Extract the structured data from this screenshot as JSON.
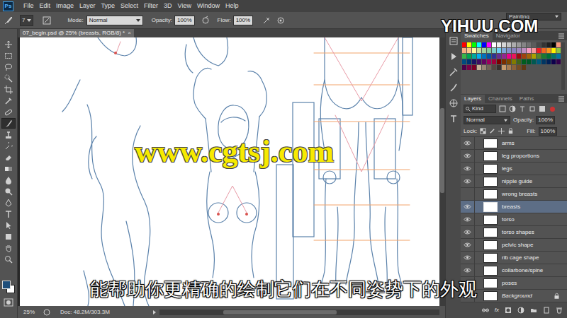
{
  "app": {
    "logo": "Ps",
    "workspace": "Painting"
  },
  "menu": [
    "File",
    "Edit",
    "Image",
    "Layer",
    "Type",
    "Select",
    "Filter",
    "3D",
    "View",
    "Window",
    "Help"
  ],
  "options": {
    "brush_size": "7",
    "mode_label": "Mode:",
    "mode": "Normal",
    "opacity_label": "Opacity:",
    "opacity": "100%",
    "flow_label": "Flow:",
    "flow": "100%"
  },
  "document": {
    "tab_title": "07_begin.psd @ 25% (breasts, RGB/8) *",
    "close": "×"
  },
  "toolbar": {
    "tools": [
      {
        "selected": false
      },
      {
        "selected": false
      },
      {
        "selected": false
      },
      {
        "selected": false
      },
      {
        "selected": false
      },
      {
        "selected": false
      },
      {
        "selected": false
      },
      {
        "selected": true
      },
      {
        "selected": false
      },
      {
        "selected": false
      },
      {
        "selected": false
      },
      {
        "selected": false
      },
      {
        "selected": false
      },
      {
        "selected": false
      },
      {
        "selected": false
      },
      {
        "selected": false
      },
      {
        "selected": false
      },
      {
        "selected": false
      },
      {
        "selected": false
      },
      {
        "selected": false
      }
    ],
    "foreground_color": "#1f4e7a",
    "background_color": "#ffffff"
  },
  "swatches_panel": {
    "tabs": [
      {
        "label": "Swatches",
        "selected": true
      },
      {
        "label": "Navigator",
        "selected": false
      }
    ],
    "swatches": [
      {
        "color": "#ff0000"
      },
      {
        "color": "#ffff00"
      },
      {
        "color": "#00ff00"
      },
      {
        "color": "#00ffff"
      },
      {
        "color": "#0000ff"
      },
      {
        "color": "#ff00ff"
      },
      {
        "color": "#ffffff"
      },
      {
        "color": "#ebebeb"
      },
      {
        "color": "#d6d6d6"
      },
      {
        "color": "#c2c2c2"
      },
      {
        "color": "#adadad"
      },
      {
        "color": "#999999"
      },
      {
        "color": "#858585"
      },
      {
        "color": "#707070"
      },
      {
        "color": "#5c5c5c"
      },
      {
        "color": "#474747"
      },
      {
        "color": "#333333"
      },
      {
        "color": "#1f1f1f"
      },
      {
        "color": "#000000"
      },
      {
        "color": "#f7977a"
      },
      {
        "color": "#f9ad81"
      },
      {
        "color": "#fdc68a"
      },
      {
        "color": "#fff79a"
      },
      {
        "color": "#c4df9b"
      },
      {
        "color": "#a2d39c"
      },
      {
        "color": "#82ca9d"
      },
      {
        "color": "#7bcdc8"
      },
      {
        "color": "#6ecff6"
      },
      {
        "color": "#7ea7d8"
      },
      {
        "color": "#8493ca"
      },
      {
        "color": "#8882be"
      },
      {
        "color": "#a187be"
      },
      {
        "color": "#bc8dbf"
      },
      {
        "color": "#f49ac2"
      },
      {
        "color": "#f6989d"
      },
      {
        "color": "#ed1c24"
      },
      {
        "color": "#f26522"
      },
      {
        "color": "#f7941d"
      },
      {
        "color": "#fff200"
      },
      {
        "color": "#8dc73f"
      },
      {
        "color": "#39b54a"
      },
      {
        "color": "#00a651"
      },
      {
        "color": "#00a99d"
      },
      {
        "color": "#00aeef"
      },
      {
        "color": "#0072bc"
      },
      {
        "color": "#0054a6"
      },
      {
        "color": "#2e3192"
      },
      {
        "color": "#662d91"
      },
      {
        "color": "#92278f"
      },
      {
        "color": "#ec008c"
      },
      {
        "color": "#ed145b"
      },
      {
        "color": "#9e0b0f"
      },
      {
        "color": "#a0410d"
      },
      {
        "color": "#a3620a"
      },
      {
        "color": "#aba000"
      },
      {
        "color": "#598527"
      },
      {
        "color": "#1a7b30"
      },
      {
        "color": "#007236"
      },
      {
        "color": "#00746b"
      },
      {
        "color": "#0076a3"
      },
      {
        "color": "#004b80"
      },
      {
        "color": "#003471"
      },
      {
        "color": "#1b1464"
      },
      {
        "color": "#440e62"
      },
      {
        "color": "#630460"
      },
      {
        "color": "#9e005d"
      },
      {
        "color": "#9e0039"
      },
      {
        "color": "#790000"
      },
      {
        "color": "#7b2e00"
      },
      {
        "color": "#7d4900"
      },
      {
        "color": "#827b00"
      },
      {
        "color": "#406618"
      },
      {
        "color": "#005e20"
      },
      {
        "color": "#005826"
      },
      {
        "color": "#005952"
      },
      {
        "color": "#005b7f"
      },
      {
        "color": "#003663"
      },
      {
        "color": "#002157"
      },
      {
        "color": "#0d004c"
      },
      {
        "color": "#32004b"
      },
      {
        "color": "#4b0049"
      },
      {
        "color": "#7b0046"
      },
      {
        "color": "#7a0026"
      },
      {
        "color": "#c7b299"
      },
      {
        "color": "#998675"
      },
      {
        "color": "#736357"
      },
      {
        "color": "#534741"
      },
      {
        "color": "#37302d"
      },
      {
        "color": "#c69c6d"
      },
      {
        "color": "#a67c52"
      },
      {
        "color": "#8c6239"
      },
      {
        "color": "#754c24"
      },
      {
        "color": "#603913"
      }
    ]
  },
  "layers_panel": {
    "tabs": [
      {
        "label": "Layers",
        "selected": true
      },
      {
        "label": "Channels",
        "selected": false
      },
      {
        "label": "Paths",
        "selected": false
      }
    ],
    "filter": "Kind",
    "blend_mode": "Normal",
    "opacity_label": "Opacity:",
    "opacity": "100%",
    "lock_label": "Lock:",
    "fill_label": "Fill:",
    "fill": "100%",
    "layers": [
      {
        "name": "arms",
        "visible": true,
        "selected": false,
        "locked": false
      },
      {
        "name": "leg proportions",
        "visible": true,
        "selected": false,
        "locked": false
      },
      {
        "name": "legs",
        "visible": true,
        "selected": false,
        "locked": false
      },
      {
        "name": "nipple guide",
        "visible": true,
        "selected": false,
        "locked": false
      },
      {
        "name": "wrong breasts",
        "visible": false,
        "selected": false,
        "locked": false
      },
      {
        "name": "breasts",
        "visible": true,
        "selected": true,
        "locked": false
      },
      {
        "name": "torso",
        "visible": true,
        "selected": false,
        "locked": false
      },
      {
        "name": "torso shapes",
        "visible": true,
        "selected": false,
        "locked": false
      },
      {
        "name": "pelvic shape",
        "visible": true,
        "selected": false,
        "locked": false
      },
      {
        "name": "rib cage shape",
        "visible": true,
        "selected": false,
        "locked": false
      },
      {
        "name": "collarbone/spine",
        "visible": true,
        "selected": false,
        "locked": false
      },
      {
        "name": "poses",
        "visible": true,
        "selected": false,
        "locked": false
      },
      {
        "name": "Background",
        "visible": true,
        "selected": false,
        "locked": true
      }
    ],
    "footer_fx": "fx"
  },
  "status_bar": {
    "zoom": "25%",
    "doc_size": "Doc: 48.2M/303.3M"
  },
  "watermarks": {
    "site": "YIHUU.COM",
    "url": "www.cgtsj.com"
  },
  "subtitle": "能帮助你更精确的绘制它们在不同姿势下的外观"
}
